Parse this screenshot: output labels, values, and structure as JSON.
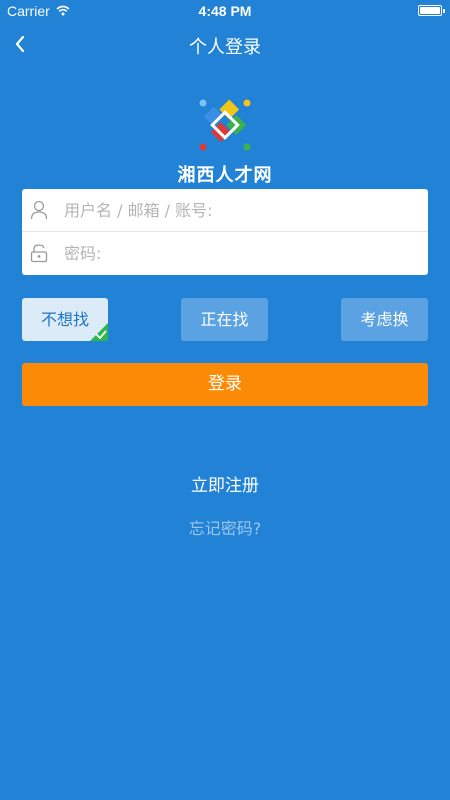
{
  "status_bar": {
    "carrier": "Carrier",
    "time": "4:48 PM"
  },
  "nav": {
    "title": "个人登录",
    "back_icon": "chevron-left-icon"
  },
  "brand": {
    "name": "湘西人才网"
  },
  "form": {
    "username_placeholder": "用户名 / 邮箱 / 账号:",
    "password_placeholder": "密码:",
    "username_icon": "user-icon",
    "password_icon": "lock-icon"
  },
  "job_status": {
    "options": [
      "不想找",
      "正在找",
      "考虑换"
    ],
    "selected": "不想找"
  },
  "actions": {
    "login_label": "登录",
    "register_label": "立即注册",
    "forgot_label": "忘记密码?"
  },
  "colors": {
    "background": "#2182d6",
    "login_button": "#fb8b06",
    "selected_option": "#dcebf8",
    "unselected_option": "#5ba2e2",
    "check_badge": "#2db84d"
  }
}
